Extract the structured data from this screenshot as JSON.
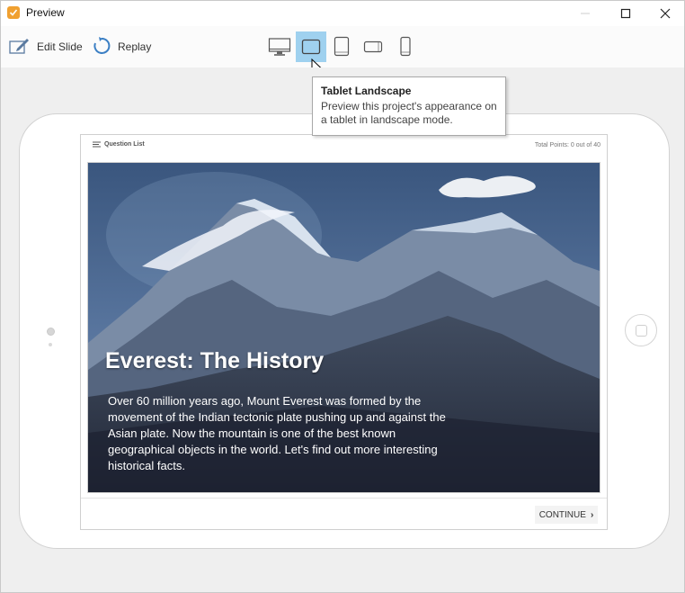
{
  "window": {
    "title": "Preview"
  },
  "toolbar": {
    "edit_slide": "Edit Slide",
    "replay": "Replay",
    "devices": [
      {
        "name": "Desktop",
        "active": false
      },
      {
        "name": "Tablet Landscape",
        "active": true
      },
      {
        "name": "Tablet Portrait",
        "active": false
      },
      {
        "name": "Phone Landscape",
        "active": false
      },
      {
        "name": "Phone Portrait",
        "active": false
      }
    ]
  },
  "tooltip": {
    "title": "Tablet Landscape",
    "body": "Preview this project's appearance on a tablet in landscape mode."
  },
  "slide_header": {
    "question_list": "Question List",
    "points": "Total Points: 0 out of 40"
  },
  "slide": {
    "title": "Everest: The History",
    "body": "Over 60 million years ago, Mount Everest was formed by the movement of the Indian tectonic plate pushing up and against the Asian plate. Now the mountain is one of the best known geographical objects in the world. Let's find out more interesting historical facts."
  },
  "footer": {
    "continue": "CONTINUE"
  },
  "colors": {
    "accent_selected": "#9fd1ef",
    "app_icon": "#f0a030",
    "sky": "#3f5b83",
    "mountain": "#5b6e88"
  }
}
